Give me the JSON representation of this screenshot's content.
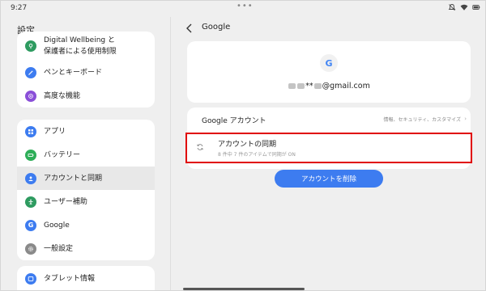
{
  "status_bar": {
    "time": "9:27",
    "dots": "•••"
  },
  "sidebar": {
    "title": "設定",
    "items": [
      {
        "label_line1": "Digital Wellbeing と",
        "label_line2": "保護者による使用制限",
        "icon": "wellbeing-icon",
        "color": "#2e9b60"
      },
      {
        "label": "ペンとキーボード",
        "icon": "pen-icon",
        "color": "#3d7cf0"
      },
      {
        "label": "高度な機能",
        "icon": "advanced-features-icon",
        "color": "#8a4fd8"
      },
      {
        "label": "アプリ",
        "icon": "apps-icon",
        "color": "#3d7cf0"
      },
      {
        "label": "バッテリー",
        "icon": "battery-icon",
        "color": "#2eae58"
      },
      {
        "label": "アカウントと同期",
        "icon": "account-icon",
        "color": "#3d7cf0"
      },
      {
        "label": "ユーザー補助",
        "icon": "accessibility-icon",
        "color": "#2e9b60"
      },
      {
        "label": "Google",
        "icon": "google-icon",
        "color": "#3d7cf0"
      },
      {
        "label": "一般設定",
        "icon": "gear-icon",
        "color": "#8a8a8a"
      },
      {
        "label": "タブレット情報",
        "icon": "tablet-info-icon",
        "color": "#3d7cf0"
      }
    ]
  },
  "detail": {
    "title": "Google",
    "account": {
      "logo_letter": "G",
      "email_mid": "**",
      "email_domain": "@gmail.com"
    },
    "google_account": {
      "label": "Google アカウント",
      "desc": "情報、セキュリティ、カスタマイズ",
      "chevron": "›"
    },
    "sync": {
      "label": "アカウントの同期",
      "desc": "8 件中 7 件のアイテムで同期が ON"
    },
    "remove_button": "アカウントを削除"
  },
  "colors": {
    "accent": "#3d7cf0",
    "highlight": "#e00000",
    "background": "#efefef"
  }
}
